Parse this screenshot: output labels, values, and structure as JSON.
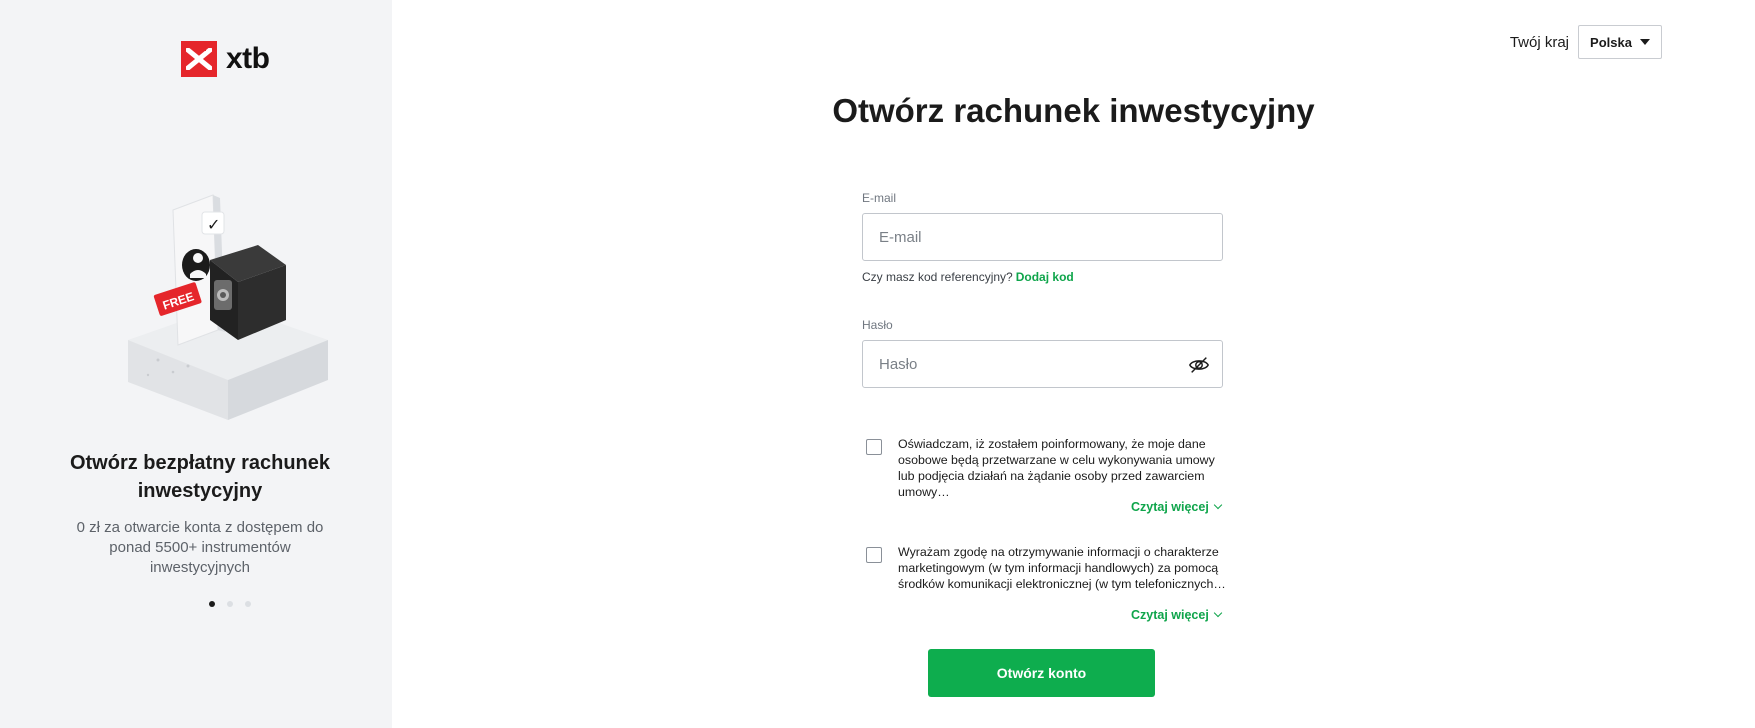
{
  "brand": {
    "name": "xtb",
    "accent": "#e5262b",
    "green": "#0ead4e"
  },
  "promo": {
    "badge": "FREE",
    "title": "Otwórz bezpłatny rachunek inwestycyjny",
    "subtitle": "0 zł za otwarcie konta z dostępem do ponad 5500+ instrumentów inwestycyjnych",
    "slides_total": 3,
    "slide_active": 1
  },
  "country": {
    "label": "Twój kraj",
    "selected": "Polska"
  },
  "form": {
    "title": "Otwórz rachunek inwestycyjny",
    "email_label": "E-mail",
    "email_placeholder": "E-mail",
    "referral_question": "Czy masz kod referencyjny?",
    "referral_link": "Dodaj kod",
    "password_label": "Hasło",
    "password_placeholder": "Hasło",
    "password_toggle_icon": "eye-off-icon",
    "consent1": "Oświadczam, iż zostałem poinformowany, że moje dane osobowe będą przetwarzane w celu wykonywania umowy lub podjęcia działań na żądanie osoby przed zawarciem umowy…",
    "consent2": "Wyrażam zgodę na otrzymywanie informacji o charakterze marketingowym (w tym informacji handlowych) za pomocą środków komunikacji elektronicznej (w tym telefonicznych…",
    "read_more": "Czytaj więcej",
    "submit": "Otwórz konto"
  }
}
